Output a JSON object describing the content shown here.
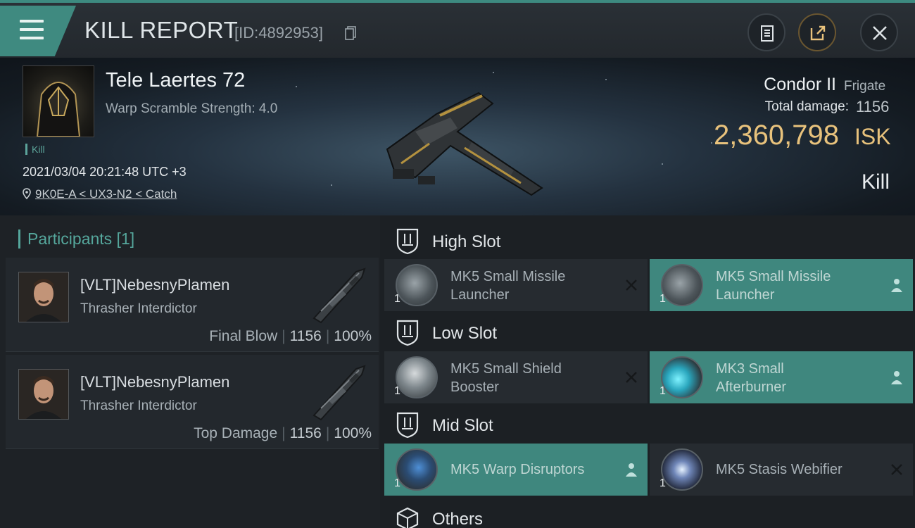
{
  "header": {
    "title": "KILL REPORT",
    "report_id": "[ID:4892953]"
  },
  "victim": {
    "name": "Tele Laertes 72",
    "stat": "Warp Scramble Strength: 4.0",
    "tag": "Kill",
    "timestamp": "2021/03/04 20:21:48 UTC +3",
    "location": "9K0E-A < UX3-N2 < Catch"
  },
  "ship": {
    "name": "Condor II",
    "class": "Frigate",
    "damage_label": "Total damage:",
    "damage_value": "1156",
    "isk_value": "2,360,798",
    "isk_unit": "ISK",
    "result": "Kill"
  },
  "participants": {
    "header": "Participants [1]",
    "rows": [
      {
        "name": "[VLT]NebesnyPlamen",
        "ship": "Thrasher Interdictor",
        "role": "Final Blow",
        "damage": "1156",
        "percent": "100%"
      },
      {
        "name": "[VLT]NebesnyPlamen",
        "ship": "Thrasher Interdictor",
        "role": "Top Damage",
        "damage": "1156",
        "percent": "100%"
      }
    ]
  },
  "slots": {
    "high": {
      "label": "High Slot",
      "modules": [
        {
          "name_line1": "MK5 Small Missile",
          "name_line2": "Launcher",
          "qty": "1",
          "state": "destroyed"
        },
        {
          "name_line1": "MK5 Small Missile",
          "name_line2": "Launcher",
          "qty": "1",
          "state": "dropped"
        }
      ]
    },
    "low": {
      "label": "Low Slot",
      "modules": [
        {
          "name_line1": "MK5 Small Shield",
          "name_line2": "Booster",
          "qty": "1",
          "state": "destroyed"
        },
        {
          "name_line1": "MK3 Small",
          "name_line2": "Afterburner",
          "qty": "1",
          "state": "dropped"
        }
      ]
    },
    "mid": {
      "label": "Mid Slot",
      "modules": [
        {
          "name": "MK5 Warp Disruptors",
          "qty": "1",
          "state": "dropped"
        },
        {
          "name": "MK5 Stasis Webifier",
          "qty": "1",
          "state": "destroyed"
        }
      ]
    },
    "others": {
      "label": "Others"
    }
  },
  "colors": {
    "accent": "#3f877e",
    "isk": "#e8c27c",
    "header_teal": "#55a79c"
  },
  "icons": [
    "menu-icon",
    "copy-icon",
    "clipboard-icon",
    "share-icon",
    "close-icon",
    "location-pin-icon",
    "shield-slot-icon",
    "cube-icon",
    "x-icon",
    "person-icon"
  ]
}
